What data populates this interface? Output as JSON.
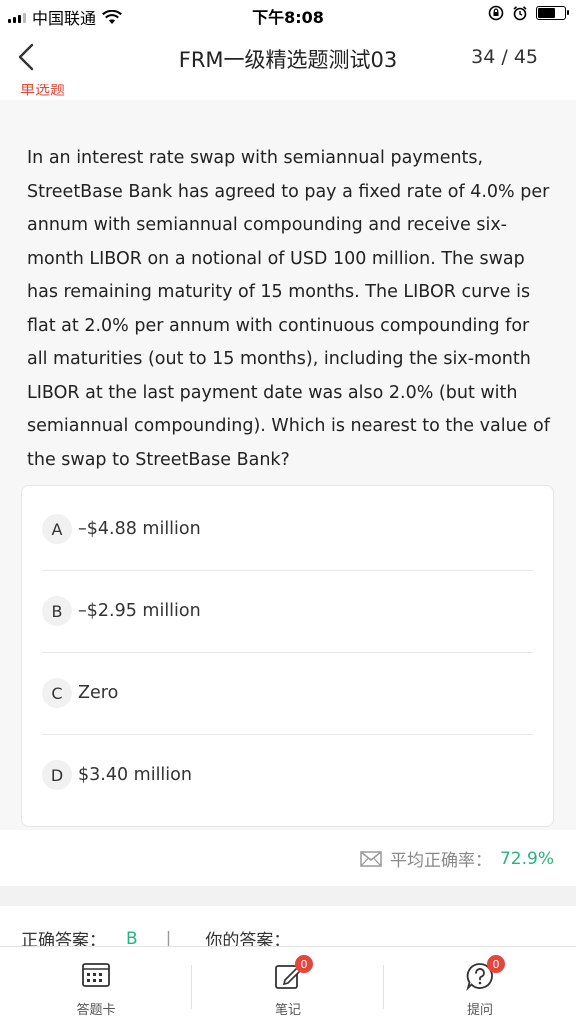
{
  "status_bar": {
    "carrier": "中国联通",
    "time": "下午8:08",
    "battery_level": 0.6
  },
  "nav": {
    "title": "FRM一级精选题测试03",
    "progress": "34 / 45"
  },
  "section_label": "单选题",
  "question": {
    "text": "In an interest rate swap with semiannual payments, StreetBase Bank has agreed to pay a fixed rate of 4.0% per annum with semiannual compounding and receive six-month LIBOR on a notional of USD 100 million. The swap has remaining maturity of 15 months. The LIBOR curve is flat at 2.0% per annum with continuous compounding for all maturities (out to 15 months), including the six-month LIBOR at the last payment date was also 2.0% (but with semiannual compounding). Which is nearest to the value of the swap to StreetBase Bank?"
  },
  "options": [
    {
      "letter": "A",
      "text": "–$4.88 million"
    },
    {
      "letter": "B",
      "text": "–$2.95 million"
    },
    {
      "letter": "C",
      "text": "Zero"
    },
    {
      "letter": "D",
      "text": "$3.40 million"
    }
  ],
  "stats": {
    "label": "平均正确率：",
    "value": "72.9%"
  },
  "answer": {
    "correct_label": "正确答案：",
    "correct_value": "B",
    "separator": "|",
    "yours_label": "你的答案："
  },
  "bottom_tabs": [
    {
      "label": "答题卡",
      "icon": "answer-card-icon"
    },
    {
      "label": "笔记",
      "icon": "note-edit-icon",
      "badge": "0"
    },
    {
      "label": "提问",
      "icon": "question-bubble-icon",
      "badge": "0"
    }
  ],
  "colors": {
    "accent_green": "#26b57c",
    "badge_red": "#e6453a",
    "section_red": "#e04a3a"
  }
}
